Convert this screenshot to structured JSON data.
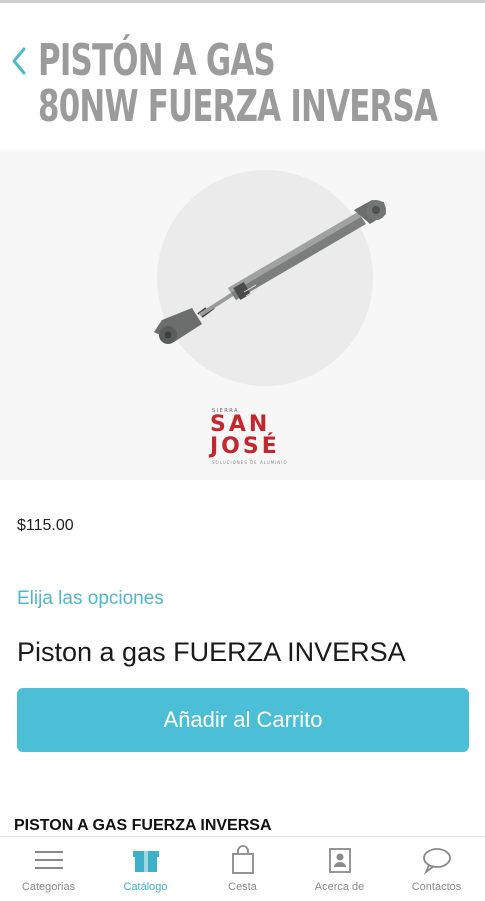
{
  "header": {
    "title_line1": "PISTÓN A GAS",
    "title_line2": "80NW FUERZA INVERSA"
  },
  "brand": {
    "small": "SIERRA",
    "line1": "SAN",
    "line2": "JOSÉ",
    "tagline": "SOLUCIONES DE ALUMINIO"
  },
  "product": {
    "price": "$115.00",
    "options_label": "Elija las opciones",
    "option_name": "Piston a gas FUERZA INVERSA",
    "add_to_cart": "Añadir al Carrito",
    "section_title": "PISTON A GAS FUERZA INVERSA"
  },
  "tabs": [
    {
      "label": "Categorias",
      "icon": "menu-icon",
      "active": false
    },
    {
      "label": "Catálogo",
      "icon": "box-icon",
      "active": true
    },
    {
      "label": "Cesta",
      "icon": "bag-icon",
      "active": false
    },
    {
      "label": "Acerca de",
      "icon": "contact-card-icon",
      "active": false
    },
    {
      "label": "Contactos",
      "icon": "chat-bubble-icon",
      "active": false
    }
  ],
  "colors": {
    "accent": "#4cbfd6",
    "title_gray": "#9b9b9b",
    "brand_red": "#c4262e",
    "active_tab": "#3fb0c9"
  }
}
